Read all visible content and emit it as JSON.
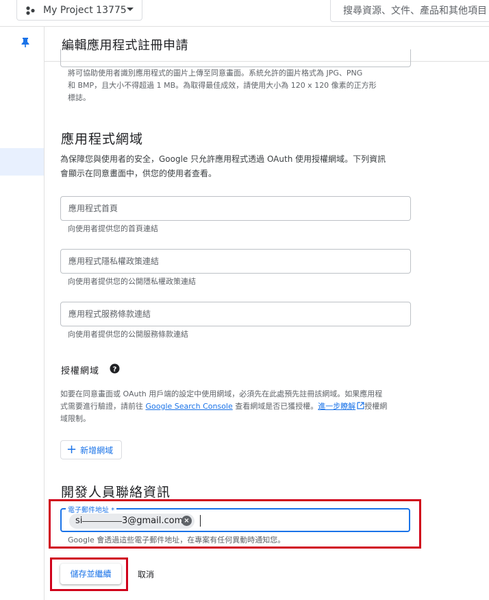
{
  "header": {
    "project_name": "My Project 13775",
    "search_placeholder": "搜尋資源、文件、產品和其他項目"
  },
  "page": {
    "title": "編輯應用程式註冊申請"
  },
  "logo_section": {
    "hint_lines": [
      "將可協助使用者識別應用程式的圖片上傳至同意畫面。系統允許的圖片格式為 JPG、PNG",
      "和 BMP，且大小不得超過 1 MB。為取得最佳成效，請使用大小為 120 x 120 像素的正方形",
      "標誌。"
    ]
  },
  "app_domain": {
    "title": "應用程式網域",
    "desc_lines": [
      "為保障您與使用者的安全，Google 只允許應用程式透過 OAuth 使用授權網域。下列資訊",
      "會顯示在同意畫面中，供您的使用者查看。"
    ],
    "fields": [
      {
        "placeholder": "應用程式首頁",
        "hint": "向使用者提供您的首頁連結"
      },
      {
        "placeholder": "應用程式隱私權政策連結",
        "hint": "向使用者提供您的公開隱私權政策連結"
      },
      {
        "placeholder": "應用程式服務條款連結",
        "hint": "向使用者提供您的公開服務條款連結"
      }
    ]
  },
  "authorized_domains": {
    "title": "授權網域",
    "help_icon": "help-circle-icon",
    "desc_line1": "如要在同意畫面或 OAuth 用戶端的設定中使用網域，必須先在此處預先註冊該網域。如果應用程",
    "desc_line2_a": "式需要進行驗證，請前往 ",
    "desc_link1": "Google Search Console",
    "desc_line2_b": " 查看網域是否已獲授權。",
    "desc_link2": "進一步瞭解",
    "external_icon": "open-in-new-icon",
    "desc_line2_c": "授權網",
    "desc_line3": "域限制。",
    "add_button": "新增網域"
  },
  "developer_contact": {
    "title": "開發人員聯絡資訊",
    "email_label": "電子郵件地址 *",
    "email_chip_a": "si",
    "email_chip_b": "3@gmail.com",
    "email_hint": "Google 會透過這些電子郵件地址，在專案有任何異動時通知您。"
  },
  "actions": {
    "save": "儲存並繼續",
    "cancel": "取消"
  },
  "colors": {
    "accent": "#1a73e8",
    "highlight_box": "#d0021b"
  }
}
